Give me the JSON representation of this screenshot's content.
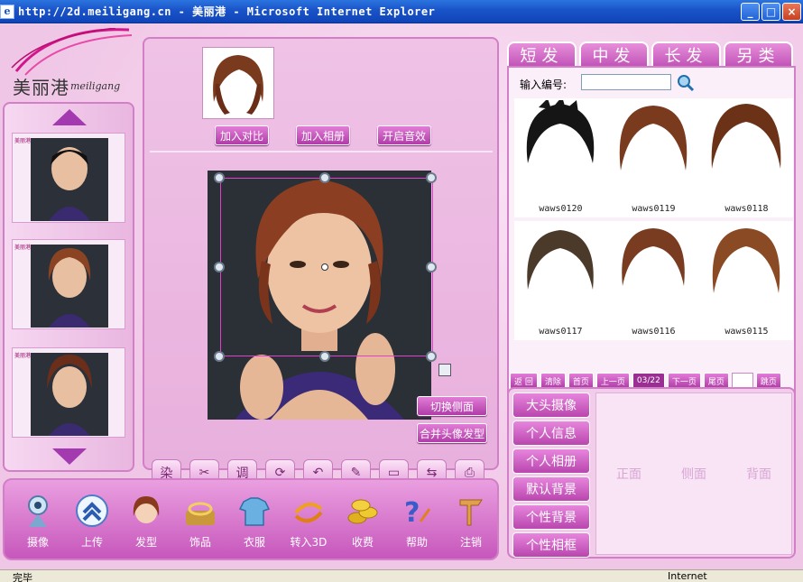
{
  "window": {
    "title": "http://2d.meiligang.cn - 美丽港 - Microsoft Internet Explorer",
    "min": "_",
    "max": "□",
    "close": "×"
  },
  "logo": {
    "cn": "美丽港",
    "en": "meiligang"
  },
  "thumb_logo": "美丽港",
  "center": {
    "buttons": {
      "add_compare": "加入对比",
      "add_album": "加入相册",
      "sound": "开启音效"
    },
    "side_buttons": {
      "switch_side": "切换侧面",
      "merge_hair": "合并头像发型"
    },
    "tools": [
      {
        "icon": "palette-icon",
        "glyph": "染"
      },
      {
        "icon": "scissors-icon",
        "glyph": "✂"
      },
      {
        "icon": "adjust-icon",
        "glyph": "调"
      },
      {
        "icon": "rotate-icon",
        "glyph": "⟳"
      },
      {
        "icon": "undo-icon",
        "glyph": "↶"
      },
      {
        "icon": "color-icon",
        "glyph": "✎"
      },
      {
        "icon": "save-icon",
        "glyph": "▭"
      },
      {
        "icon": "flip-icon",
        "glyph": "⇆"
      },
      {
        "icon": "print-icon",
        "glyph": "⎙"
      }
    ]
  },
  "tabs": [
    "短发",
    "中发",
    "长发",
    "另类"
  ],
  "search": {
    "label": "输入编号:",
    "value": ""
  },
  "hairstyles": [
    {
      "code": "waws0120",
      "color": "#151515"
    },
    {
      "code": "waws0119",
      "color": "#7a3a1e"
    },
    {
      "code": "waws0118",
      "color": "#6b3218"
    },
    {
      "code": "waws0117",
      "color": "#4b3a2a"
    },
    {
      "code": "waws0116",
      "color": "#7a3c20"
    },
    {
      "code": "waws0115",
      "color": "#8a4a24"
    }
  ],
  "pager": {
    "back": "返 回",
    "clear": "清除",
    "first": "首页",
    "prev": "上一页",
    "page": "03/22",
    "next": "下一页",
    "last": "尾页",
    "jump": "跳页"
  },
  "menu": [
    "大头摄像",
    "个人信息",
    "个人相册",
    "默认背景",
    "个性背景",
    "个性相框"
  ],
  "views": [
    "正面",
    "侧面",
    "背面"
  ],
  "bottom": [
    {
      "label": "摄像",
      "icon": "camera-icon"
    },
    {
      "label": "上传",
      "icon": "upload-icon"
    },
    {
      "label": "发型",
      "icon": "hairstyle-icon"
    },
    {
      "label": "饰品",
      "icon": "accessory-icon"
    },
    {
      "label": "衣服",
      "icon": "clothes-icon"
    },
    {
      "label": "转入3D",
      "icon": "3d-icon"
    },
    {
      "label": "收费",
      "icon": "coins-icon"
    },
    {
      "label": "帮助",
      "icon": "help-icon"
    },
    {
      "label": "注销",
      "icon": "logout-icon"
    }
  ],
  "status": {
    "left": "完毕",
    "right": "Internet"
  }
}
